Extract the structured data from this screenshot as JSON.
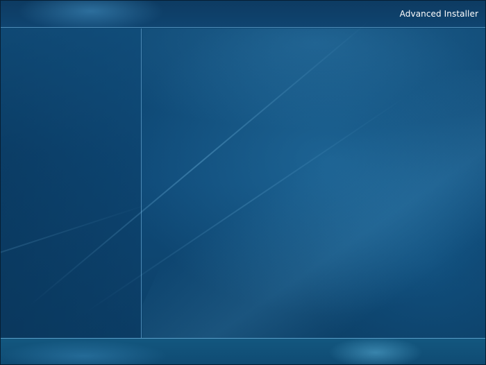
{
  "header": {
    "brand": "Advanced Installer"
  },
  "colors": {
    "background": "#0f4a78",
    "header_bar": "#0d3b62",
    "divider_line": "#4f8db8",
    "brand_text": "#ffffff"
  }
}
